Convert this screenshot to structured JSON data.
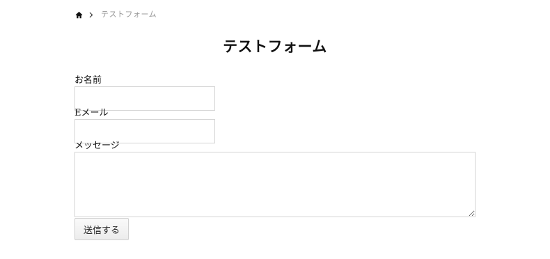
{
  "breadcrumb": {
    "home_icon": "home-icon",
    "separator_icon": "chevron-right-icon",
    "current": "テストフォーム"
  },
  "page": {
    "title": "テストフォーム"
  },
  "form": {
    "name_label": "お名前",
    "name_value": "",
    "email_label": "Eメール",
    "email_value": "",
    "message_label": "メッセージ",
    "message_value": "",
    "submit_label": "送信する"
  },
  "colors": {
    "text": "#111111",
    "breadcrumb_muted": "#999999",
    "field_border": "#d4d4d4",
    "button_bg": "#ececec"
  }
}
